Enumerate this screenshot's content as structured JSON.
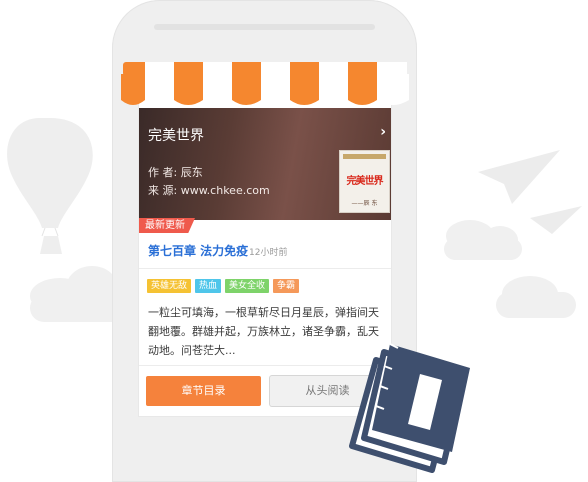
{
  "book": {
    "title": "完美世界",
    "author": "作 者: 辰东",
    "source": "来 源: www.chkee.com",
    "cover_title": "完美世界",
    "cover_sub": "——辰 东"
  },
  "latest": {
    "badge": "最新更新",
    "chapter": "第七百章 法力免疫",
    "time": "12小时前"
  },
  "tags": [
    {
      "label": "英雄无敌",
      "color": "#f5c233"
    },
    {
      "label": "热血",
      "color": "#4fc6ea"
    },
    {
      "label": "美女全收",
      "color": "#7ed36a"
    },
    {
      "label": "争霸",
      "color": "#f5995a"
    }
  ],
  "intro": "一粒尘可填海，一根草斩尽日月星辰，弹指间天翻地覆。群雄并起，万族林立，诸圣争霸，乱天动地。问苍茫大...",
  "actions": {
    "catalog": "章节目录",
    "read_from_start": "从头阅读"
  },
  "colors": {
    "accent": "#f5823c",
    "link": "#2a6fd6",
    "badge": "#ef5a4c",
    "awning_orange": "#f5872f",
    "books_navy": "#3e4f6e"
  }
}
